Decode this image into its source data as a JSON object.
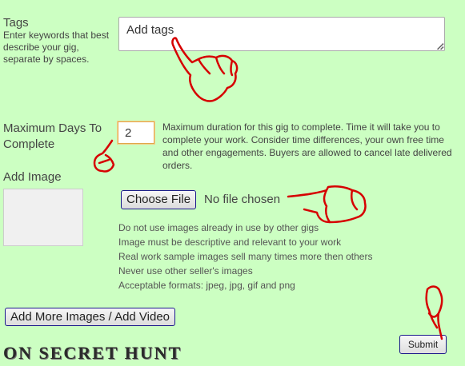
{
  "tags": {
    "label": "Tags",
    "hint": "Enter keywords that best describe your gig, separate by spaces.",
    "value": "Add tags"
  },
  "max_days": {
    "label": "Maximum Days To Complete",
    "value": "2",
    "hint": "Maximum duration for this gig to complete. Time it will take you to complete your work. Consider time differences, your own free time and other engagements. Buyers are allowed to cancel late delivered orders."
  },
  "add_image": {
    "label": "Add Image",
    "choose_button": "Choose File",
    "no_file_text": "No file chosen",
    "rules": [
      "Do not use images already in use by other gigs",
      "Image must be descriptive and relevant to your work",
      "Real work sample images sell many times more then others",
      "Never use other seller's images",
      "Acceptable formats: jpeg, jpg, gif and png"
    ]
  },
  "add_more_button": "Add More Images / Add Video",
  "submit_button": "Submit",
  "watermark": "ON SECRET HUNT",
  "colors": {
    "background": "#ccffc2",
    "annotation": "#d60000",
    "button_border": "#1a1a8a"
  },
  "annotations": [
    "pointing-hand-icon",
    "pointing-hand-icon",
    "pointing-hand-icon",
    "pointing-hand-icon"
  ]
}
